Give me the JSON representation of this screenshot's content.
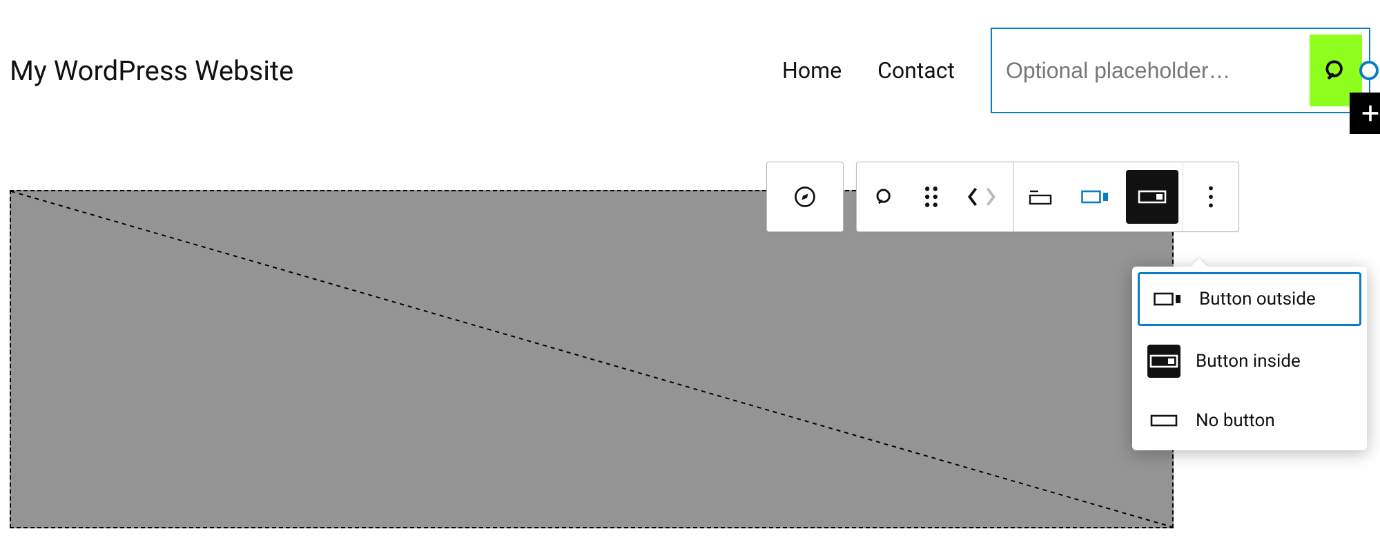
{
  "site": {
    "title": "My WordPress Website"
  },
  "nav": {
    "home": "Home",
    "contact": "Contact"
  },
  "search": {
    "placeholder": "Optional placeholder…",
    "button_color": "#8fff1e"
  },
  "toolbar": {
    "compass": "compass",
    "search": "search",
    "drag": "drag",
    "move_prev_enabled": true,
    "move_next_enabled": false
  },
  "dropdown": {
    "items": [
      {
        "label": "Button outside",
        "selected": true,
        "icon": "button-outside"
      },
      {
        "label": "Button inside",
        "selected": false,
        "icon": "button-inside",
        "dark": true
      },
      {
        "label": "No button",
        "selected": false,
        "icon": "no-button"
      }
    ]
  }
}
